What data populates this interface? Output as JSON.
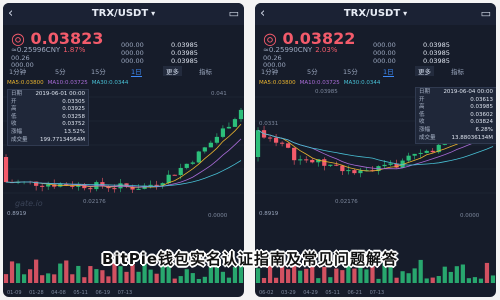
{
  "colors": {
    "up": "#2cbf7a",
    "down": "#f35b6b",
    "accent": "#3d8af7",
    "bg": "#161c2a"
  },
  "icons": {
    "back": "back-arrow-icon",
    "menu": "menu-icon",
    "dropdown": "caret-down-icon"
  },
  "left": {
    "pair": "TRX/USDT",
    "price": "◎ 0.03823",
    "change_abs": "≈0.25996CNY",
    "change_pct": "1.87%",
    "quote1_label": "00.26",
    "quote2_label": "000.00",
    "hl_rows": [
      {
        "label": "000.00",
        "value": "0.03985"
      },
      {
        "label": "000.00",
        "value": "0.03985"
      },
      {
        "label": "000.00",
        "value": "0.03985"
      }
    ],
    "tabs": [
      "1分钟",
      "5分",
      "15分",
      "1日",
      "更多",
      "指标"
    ],
    "tab_active_index": 3,
    "ma": [
      "MA5:0.03800",
      "MA10:0.03725",
      "MA30:0.0344"
    ],
    "tooltip": [
      {
        "label": "日期",
        "value": "2019-06-01 00:00"
      },
      {
        "label": "开",
        "value": "0.03305"
      },
      {
        "label": "高",
        "value": "0.03925"
      },
      {
        "label": "低",
        "value": "0.03258"
      },
      {
        "label": "收",
        "value": "0.03752"
      },
      {
        "label": "涨幅",
        "value": "13.52%"
      },
      {
        "label": "成交量",
        "value": "199.77134564M"
      }
    ],
    "axis_top": "0.041",
    "axis_low": "0.02176",
    "vol_label": "0.8919",
    "vol_label2": "0.0000",
    "dates": "01-09  01-28  04-08  05-11  06-19  07-13",
    "watermark": "gate.io"
  },
  "right": {
    "pair": "TRX/USDT",
    "price": "◎ 0.03822",
    "change_abs": "≈0.25990CNY",
    "change_pct": "2.03%",
    "quote1_label": "00.26",
    "quote2_label": "000.00",
    "hl_rows": [
      {
        "label": "000.00",
        "value": "0.03985"
      },
      {
        "label": "000.00",
        "value": "0.03985"
      },
      {
        "label": "000.00",
        "value": "0.03985"
      }
    ],
    "tabs": [
      "1分钟",
      "5分",
      "15分",
      "1日",
      "更多",
      "指标"
    ],
    "tab_active_index": 3,
    "ma": [
      "MA5:0.03800",
      "MA10:0.03725",
      "MA30:0.0344"
    ],
    "tooltip": [
      {
        "label": "日期",
        "value": "2019-06-04 00:00"
      },
      {
        "label": "开",
        "value": "0.03613"
      },
      {
        "label": "高",
        "value": "0.03985"
      },
      {
        "label": "低",
        "value": "0.03602"
      },
      {
        "label": "收",
        "value": "0.03824"
      },
      {
        "label": "涨幅",
        "value": "6.28%"
      },
      {
        "label": "成交量",
        "value": "13.88036134M"
      }
    ],
    "axis_top": "0.03985",
    "axis_mid": "0.0331",
    "axis_low": "0.02176",
    "vol_label": "0.8919",
    "vol_label2": "0.0000",
    "dates": "06-02  03-29  04-29  05-11  06-21  07-13",
    "watermark": ""
  },
  "banner": "BitPie钱包实名认证指南及常见问题解答"
}
